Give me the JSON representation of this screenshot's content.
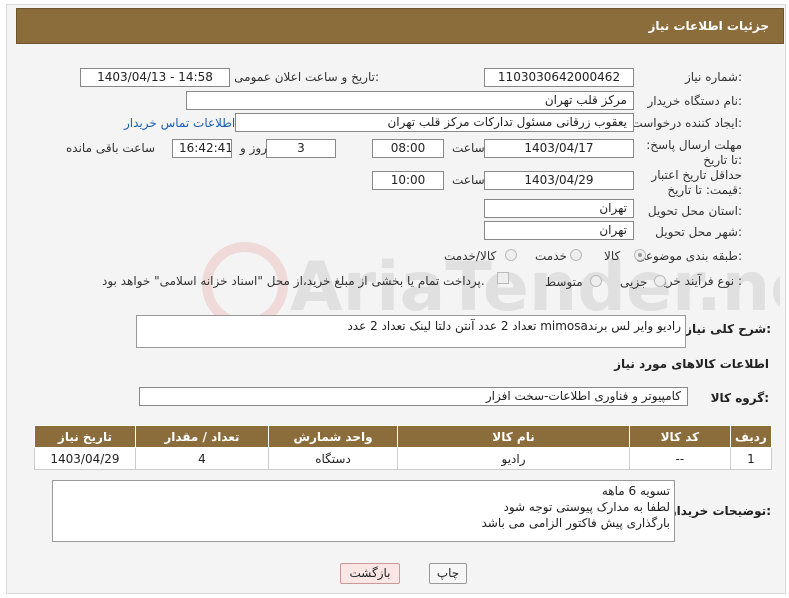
{
  "header": {
    "title": "جزئیات اطلاعات نیاز"
  },
  "form": {
    "need_number_label": "شماره نیاز:",
    "need_number": "1103030642000462",
    "announce_label": "تاریخ و ساعت اعلان عمومی:",
    "announce_value": "1403/04/13 - 14:58",
    "buyer_org_label": "نام دستگاه خریدار:",
    "buyer_org": "مرکز قلب تهران",
    "requester_label": "ایجاد کننده درخواست:",
    "requester": "یعقوب زرقانی مسئول تدارکات مرکز قلب تهران",
    "contact_link": "اطلاعات تماس خریدار",
    "deadline_label": "مهلت ارسال پاسخ: تا تاریخ:",
    "deadline_date": "1403/04/17",
    "time_label": "ساعت",
    "deadline_time": "08:00",
    "days_value": "3",
    "days_label": "روز و",
    "remaining_time": "16:42:41",
    "remaining_label": "ساعت باقی مانده",
    "validity_label": "حداقل تاریخ اعتبار قیمت: تا تاریخ:",
    "validity_date": "1403/04/29",
    "validity_time": "10:00",
    "province_label": "استان محل تحویل:",
    "province": "تهران",
    "city_label": "شهر محل تحویل:",
    "city": "تهران",
    "category_label": "طبقه بندی موضوعی:",
    "category_options": [
      "کالا",
      "خدمت",
      "کالا/خدمت"
    ],
    "process_label": "نوع فرآیند خرید :",
    "process_options": [
      "جزیی",
      "متوسط"
    ],
    "payment_note": "پرداخت تمام یا بخشی از مبلغ خرید،از محل \"اسناد خزانه اسلامی\" خواهد بود."
  },
  "description": {
    "label": "شرح کلی نیاز:",
    "text": "رادیو وایر لس برندmimosa تعداد 2 عدد  آنتن دلتا لینک تعداد 2 عدد"
  },
  "goods": {
    "section_title": "اطلاعات کالاهای مورد نیاز",
    "group_label": "گروه کالا:",
    "group_value": "کامپیوتر و فناوری اطلاعات-سخت افزار",
    "columns": [
      "ردیف",
      "کد کالا",
      "نام کالا",
      "واحد شمارش",
      "تعداد / مقدار",
      "تاریخ نیاز"
    ],
    "rows": [
      {
        "row": "1",
        "code": "--",
        "name": "رادیو",
        "unit": "دستگاه",
        "qty": "4",
        "date": "1403/04/29"
      }
    ]
  },
  "buyer_notes": {
    "label": "توضیحات خریدار:",
    "text": "تسویه 6 ماهه\nلطفا به مدارک پیوستی توجه شود\nبارگذاری پیش فاکتور الزامی می باشد"
  },
  "buttons": {
    "print": "چاپ",
    "back": "بازگشت"
  },
  "colors": {
    "header_bg": "#8b6d3c",
    "link": "#1a5fb4"
  }
}
